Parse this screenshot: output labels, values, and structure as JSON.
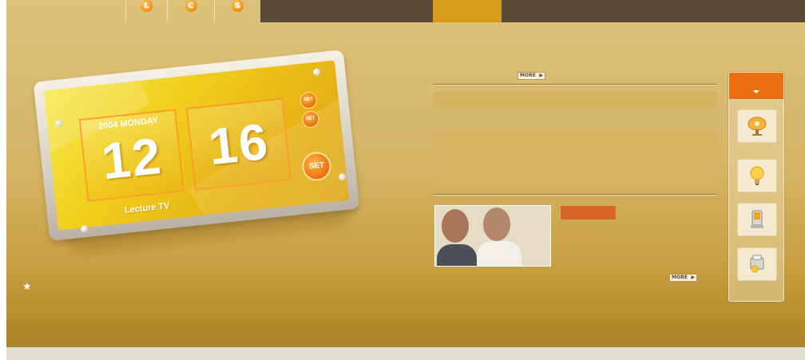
{
  "top_nav": {
    "tabs": [
      {
        "icon": "L"
      },
      {
        "icon": "C"
      },
      {
        "icon": "S"
      }
    ]
  },
  "clock": {
    "date_text": "2004 MONDAY",
    "hour": "12",
    "minute": "16",
    "brand": "Lecture TV",
    "set_small_1": "SET",
    "set_small_2": "SET",
    "set_big": "SET"
  },
  "news": {
    "more_label": "MORE",
    "photo_more_label": "MORE"
  },
  "quick_panel": {
    "items": [
      {
        "icon": "satellite-dish-icon"
      },
      {
        "icon": "lightbulb-icon"
      },
      {
        "icon": "pda-icon"
      },
      {
        "icon": "printer-icon"
      }
    ]
  },
  "colors": {
    "accent_orange": "#ed6d13",
    "nav_dark": "#5a4a36",
    "nav_active": "#d89a1a",
    "label_orange": "#d9652b"
  }
}
